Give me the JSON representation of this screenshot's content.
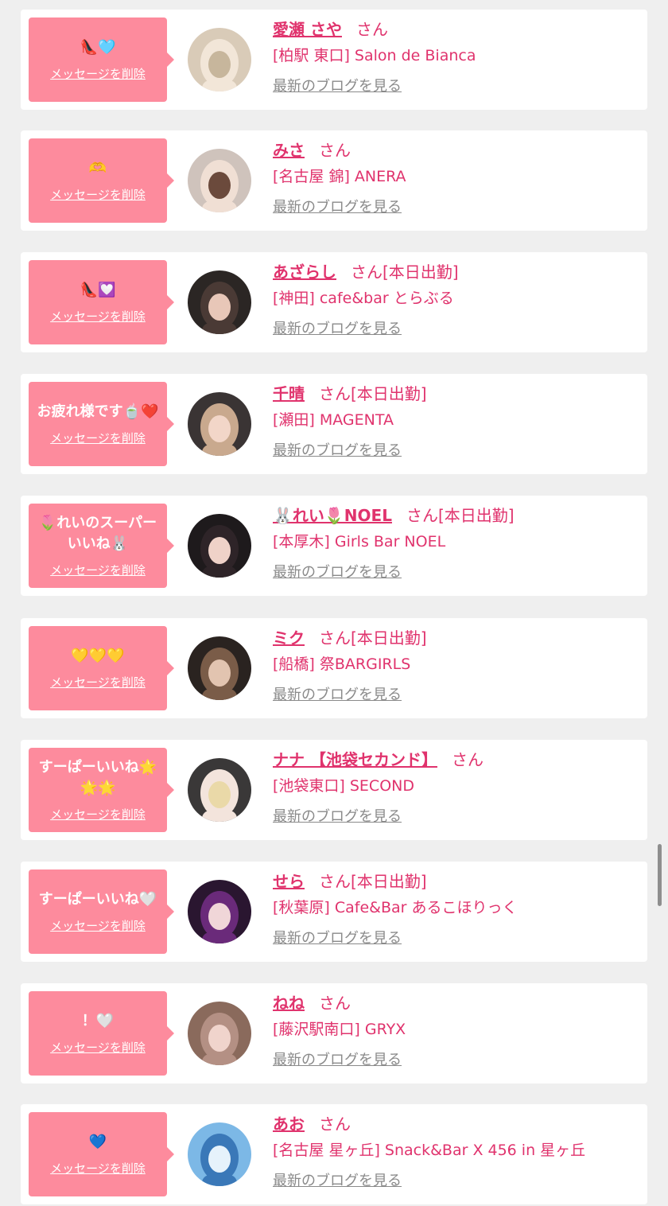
{
  "delete_label": "メッセージを削除",
  "blog_label": "最新のブログを見る",
  "san_label": "さん",
  "messages": [
    {
      "message": "👠🩵",
      "name": "愛瀬 さや",
      "working_badge": "",
      "shop": "[柏駅 東口] Salon de Bianca",
      "avatar_colors": [
        "#d9cbb8",
        "#c7b69c",
        "#f2e6d8"
      ]
    },
    {
      "message": "🫶",
      "name": "みさ",
      "working_badge": "",
      "shop": "[名古屋 錦] ANERA",
      "avatar_colors": [
        "#cfc3bc",
        "#6b4a3c",
        "#f0dfd4"
      ]
    },
    {
      "message": "👠💟",
      "name": "あざらし",
      "working_badge": "[本日出勤]",
      "shop": "[神田] cafe&bar とらぶる",
      "avatar_colors": [
        "#2b2624",
        "#e8c7b8",
        "#4a3a35"
      ]
    },
    {
      "message": "お疲れ様です🍵❤️",
      "name": "千晴",
      "working_badge": "[本日出勤]",
      "shop": "[瀬田] MAGENTA",
      "avatar_colors": [
        "#3a3434",
        "#f2d6c8",
        "#c9a98e"
      ]
    },
    {
      "message": "🌷れいのスーパーいいね🐰",
      "name": "🐰れい🌷NOEL",
      "working_badge": "[本日出勤]",
      "shop": "[本厚木] Girls Bar NOEL",
      "avatar_colors": [
        "#1e1a1c",
        "#efd2c8",
        "#2e2428"
      ]
    },
    {
      "message": "💛💛💛",
      "name": "ミク",
      "working_badge": "[本日出勤]",
      "shop": "[船橋] 祭BARGIRLS",
      "avatar_colors": [
        "#2a2320",
        "#e2c4b0",
        "#7a5c48"
      ]
    },
    {
      "message": "すーぱーいいね🌟🌟🌟",
      "name": "ナナ 【池袋セカンド】",
      "working_badge": "",
      "shop": "[池袋東口] SECOND",
      "avatar_colors": [
        "#3a3838",
        "#ead9a8",
        "#f3e4dc"
      ]
    },
    {
      "message": "すーぱーいいね🤍",
      "name": "せら",
      "working_badge": "[本日出勤]",
      "shop": "[秋葉原] Cafe&Bar あるこほりっく",
      "avatar_colors": [
        "#2a1630",
        "#f0d6d8",
        "#6a2a7a"
      ]
    },
    {
      "message": "！🤍",
      "name": "ねね",
      "working_badge": "",
      "shop": "[藤沢駅南口] GRYX",
      "avatar_colors": [
        "#8a6a5c",
        "#f0d4cc",
        "#b49084"
      ]
    },
    {
      "message": "💙",
      "name": "あお",
      "working_badge": "",
      "shop": "[名古屋 星ヶ丘] Snack&Bar X 456 in 星ヶ丘",
      "avatar_colors": [
        "#7cb8e6",
        "#e6f2fb",
        "#3a78b8"
      ]
    }
  ],
  "colors": {
    "accent": "#e0336d",
    "bubble": "#fd8b9d",
    "background": "#efefef",
    "link_gray": "#8a8a8a"
  }
}
